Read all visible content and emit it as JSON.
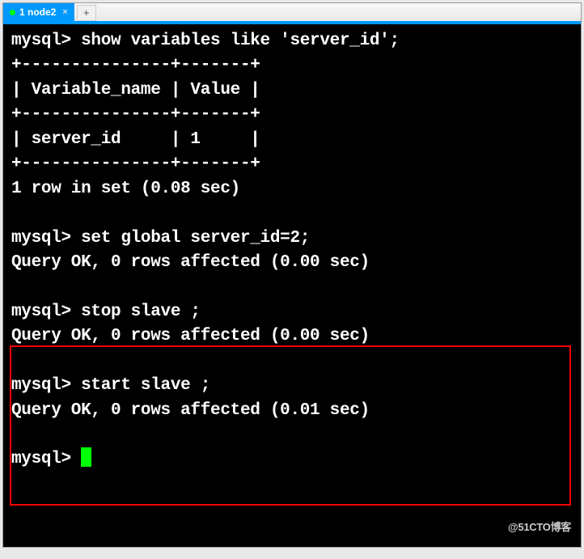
{
  "tab": {
    "label": "1 node2",
    "close": "×"
  },
  "newtab": "+",
  "term": {
    "l1": "mysql> show variables like 'server_id';",
    "l2": "+---------------+-------+",
    "l3": "| Variable_name | Value |",
    "l4": "+---------------+-------+",
    "l5": "| server_id     | 1     |",
    "l6": "+---------------+-------+",
    "l7": "1 row in set (0.08 sec)",
    "l8": "",
    "l9": "mysql> set global server_id=2;",
    "l10": "Query OK, 0 rows affected (0.00 sec)",
    "l11": "",
    "l12": "mysql> stop slave ;",
    "l13": "Query OK, 0 rows affected (0.00 sec)",
    "l14": "",
    "l15": "mysql> start slave ;",
    "l16": "Query OK, 0 rows affected (0.01 sec)",
    "l17": "",
    "l18": "mysql> "
  },
  "watermark": "@51CTO博客"
}
